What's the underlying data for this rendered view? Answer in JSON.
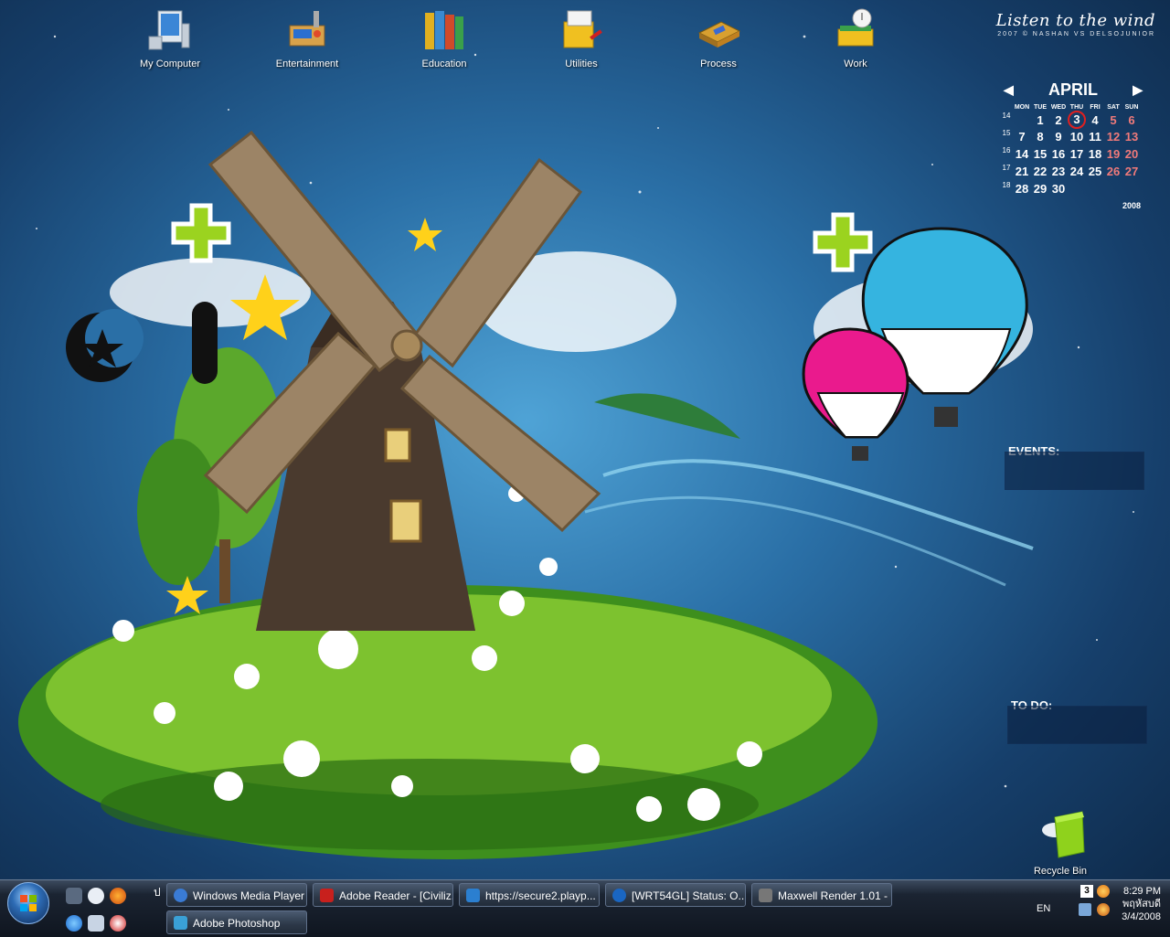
{
  "wallpaper": {
    "title": "Listen to the wind",
    "credit": "2007 © NASHAN VS DELSOJUNIOR"
  },
  "desktop_icons": [
    {
      "label": "My Computer",
      "icon": "computer-icon"
    },
    {
      "label": "Entertainment",
      "icon": "media-icon"
    },
    {
      "label": "Education",
      "icon": "books-icon"
    },
    {
      "label": "Utilities",
      "icon": "tools-icon"
    },
    {
      "label": "Process",
      "icon": "chip-icon"
    },
    {
      "label": "Work",
      "icon": "notes-icon"
    }
  ],
  "calendar": {
    "month": "APRIL",
    "year": "2008",
    "weekdays": [
      "MON",
      "TUE",
      "WED",
      "THU",
      "FRI",
      "SAT",
      "SUN"
    ],
    "today": "3",
    "weeks": [
      {
        "num": "14",
        "days": [
          "",
          "1",
          "2",
          "3",
          "4",
          "5",
          "6"
        ]
      },
      {
        "num": "15",
        "days": [
          "7",
          "8",
          "9",
          "10",
          "11",
          "12",
          "13"
        ]
      },
      {
        "num": "16",
        "days": [
          "14",
          "15",
          "16",
          "17",
          "18",
          "19",
          "20"
        ]
      },
      {
        "num": "17",
        "days": [
          "21",
          "22",
          "23",
          "24",
          "25",
          "26",
          "27"
        ]
      },
      {
        "num": "18",
        "days": [
          "28",
          "29",
          "30",
          "",
          "",
          "",
          ""
        ]
      }
    ]
  },
  "widgets": {
    "events_label": "EVENTS:",
    "todo_label": "TO DO:"
  },
  "recycle_bin": {
    "label": "Recycle Bin"
  },
  "taskbar": {
    "quicklaunch_separator": "ป",
    "tasks": [
      {
        "label": "Windows Media Player",
        "color": "#3a7bd5"
      },
      {
        "label": "Adobe Reader - [Civiliz...",
        "color": "#c8201d"
      },
      {
        "label": "https://secure2.playp...",
        "color": "#2b7fd0"
      },
      {
        "label": "[WRT54GL] Status: O...",
        "color": "#1a66c2"
      },
      {
        "label": "Maxwell Render 1.01 - ...",
        "color": "#777777"
      },
      {
        "label": "Adobe Photoshop",
        "color": "#3aa0d6"
      }
    ],
    "tray": {
      "lang": "EN",
      "badge": "3",
      "time": "8:29 PM",
      "day": "พฤหัสบดี",
      "date": "3/4/2008"
    }
  }
}
